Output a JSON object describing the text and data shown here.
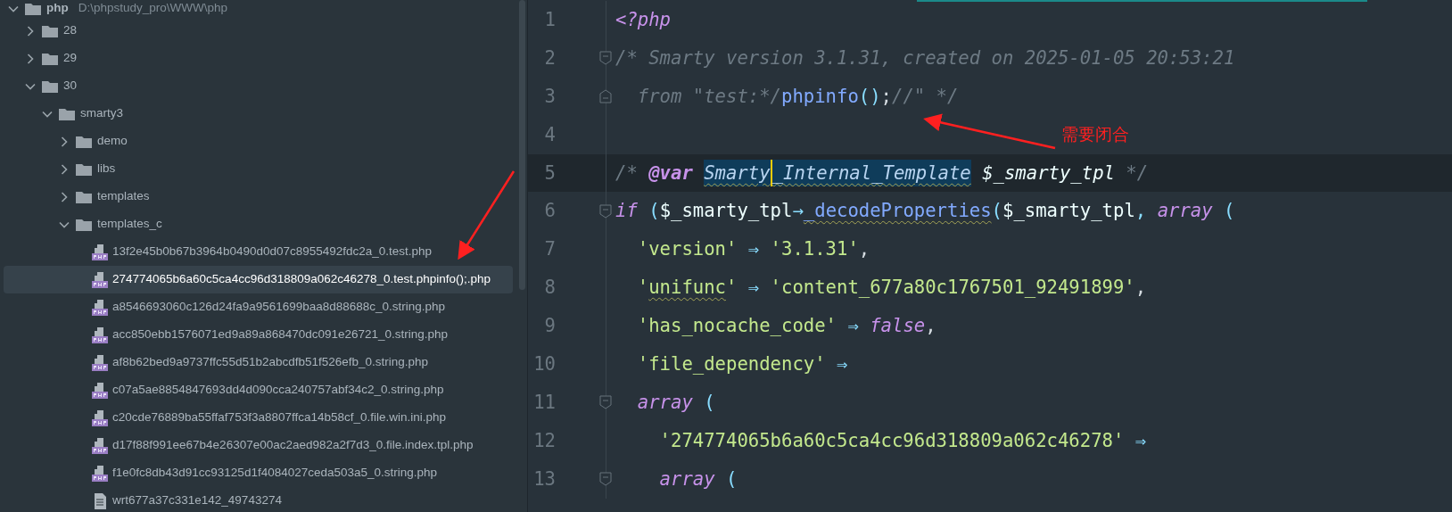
{
  "project_tree": {
    "items": [
      {
        "kind": "folder",
        "label": "php",
        "path": "D:\\phpstudy_pro\\WWW\\php",
        "expanded": true,
        "selected": false,
        "children": [
          {
            "kind": "folder",
            "label": "28",
            "expanded": false,
            "selected": false
          },
          {
            "kind": "folder",
            "label": "29",
            "expanded": false,
            "selected": false
          },
          {
            "kind": "folder",
            "label": "30",
            "expanded": true,
            "selected": false,
            "children": [
              {
                "kind": "folder",
                "label": "smarty3",
                "expanded": true,
                "selected": false,
                "children": [
                  {
                    "kind": "folder",
                    "label": "demo",
                    "expanded": false,
                    "selected": false
                  },
                  {
                    "kind": "folder",
                    "label": "libs",
                    "expanded": false,
                    "selected": false
                  },
                  {
                    "kind": "folder",
                    "label": "templates",
                    "expanded": false,
                    "selected": false
                  },
                  {
                    "kind": "folder",
                    "label": "templates_c",
                    "expanded": true,
                    "selected": false,
                    "children": [
                      {
                        "kind": "php",
                        "label": "13f2e45b0b67b3964b0490d0d07c8955492fdc2a_0.test.php",
                        "selected": false
                      },
                      {
                        "kind": "php",
                        "label": "274774065b6a60c5ca4cc96d318809a062c46278_0.test.phpinfo();.php",
                        "selected": true
                      },
                      {
                        "kind": "php",
                        "label": "a8546693060c126d24fa9a9561699baa8d88688c_0.string.php",
                        "selected": false
                      },
                      {
                        "kind": "php",
                        "label": "acc850ebb1576071ed9a89a868470dc091e26721_0.string.php",
                        "selected": false
                      },
                      {
                        "kind": "php",
                        "label": "af8b62bed9a9737ffc55d51b2abcdfb51f526efb_0.string.php",
                        "selected": false
                      },
                      {
                        "kind": "php",
                        "label": "c07a5ae8854847693dd4d090cca240757abf34c2_0.string.php",
                        "selected": false
                      },
                      {
                        "kind": "php",
                        "label": "c20cde76889ba55ffaf753f3a8807ffca14b58cf_0.file.win.ini.php",
                        "selected": false
                      },
                      {
                        "kind": "php",
                        "label": "d17f88f991ee67b4e26307e00ac2aed982a2f7d3_0.file.index.tpl.php",
                        "selected": false
                      },
                      {
                        "kind": "php",
                        "label": "f1e0fc8db43d91cc93125d1f4084027ceda503a5_0.string.php",
                        "selected": false
                      },
                      {
                        "kind": "file",
                        "label": "wrt677a37c331e142_49743274",
                        "selected": false
                      }
                    ]
                  }
                ]
              }
            ]
          }
        ]
      }
    ]
  },
  "editor": {
    "lines": [
      {
        "number": "1",
        "current": false,
        "kind": "plain",
        "segments": [
          {
            "kind": "keyword",
            "text": "<?php"
          }
        ]
      },
      {
        "number": "2",
        "current": false,
        "kind": "foldstart",
        "segments": [
          {
            "kind": "comment",
            "text": "/* Smarty version 3.1.31, created on 2025-01-05 20:53:21"
          }
        ]
      },
      {
        "number": "3",
        "current": false,
        "kind": "foldend",
        "segments": [
          {
            "kind": "comment",
            "text": "  from \"test:*/"
          },
          {
            "kind": "function",
            "text": "phpinfo"
          },
          {
            "kind": "paren",
            "text": "()"
          },
          {
            "kind": "plain",
            "text": ";"
          },
          {
            "kind": "comment",
            "text": "//\" */"
          }
        ]
      },
      {
        "number": "4",
        "current": false,
        "kind": "plain"
      },
      {
        "number": "5",
        "current": true,
        "kind": "plain",
        "segments": [
          {
            "kind": "comment",
            "text": "/* "
          },
          {
            "kind": "doctag",
            "text": "@var"
          },
          {
            "kind": "type",
            "text": "Smarty",
            "selected": true,
            "caret": true,
            "squiggly": true
          },
          {
            "kind": "type",
            "text": "_Internal_Template",
            "selected": true,
            "squiggly": true
          },
          {
            "kind": "doctype",
            "text": " $_smarty_tpl"
          },
          {
            "kind": "comment",
            "text": " */"
          }
        ]
      },
      {
        "number": "6",
        "current": false,
        "kind": "foldstart",
        "segments": [
          {
            "kind": "keyword",
            "text": "if"
          },
          {
            "kind": "paren",
            "text": " ("
          },
          {
            "kind": "variable",
            "text": "$_smarty_tpl"
          },
          {
            "kind": "operator",
            "text": "→"
          },
          {
            "kind": "function",
            "text": "_decodeProperties",
            "squiggly": true
          },
          {
            "kind": "paren",
            "text": "("
          },
          {
            "kind": "variable",
            "text": "$_smarty_tpl"
          },
          {
            "kind": "operator",
            "text": ", "
          },
          {
            "kind": "keyword",
            "text": "array"
          },
          {
            "kind": "paren",
            "text": " ("
          }
        ]
      },
      {
        "number": "7",
        "current": false,
        "kind": "plain",
        "segments": [
          {
            "kind": "string",
            "text": "  'version'"
          },
          {
            "kind": "operator",
            "text": " ⇒ "
          },
          {
            "kind": "string",
            "text": "'3.1.31'"
          },
          {
            "kind": "plain",
            "text": ","
          }
        ]
      },
      {
        "number": "8",
        "current": false,
        "kind": "plain",
        "segments": [
          {
            "kind": "string",
            "text": "  '"
          },
          {
            "kind": "string",
            "text": "unifunc",
            "squiggly": true
          },
          {
            "kind": "string",
            "text": "'"
          },
          {
            "kind": "operator",
            "text": " ⇒ "
          },
          {
            "kind": "string",
            "text": "'content_677a80c1767501_92491899'"
          },
          {
            "kind": "plain",
            "text": ","
          }
        ]
      },
      {
        "number": "9",
        "current": false,
        "kind": "plain",
        "segments": [
          {
            "kind": "string",
            "text": "  'has_nocache_code'"
          },
          {
            "kind": "operator",
            "text": " ⇒ "
          },
          {
            "kind": "keyword",
            "text": "false"
          },
          {
            "kind": "plain",
            "text": ","
          }
        ]
      },
      {
        "number": "10",
        "current": false,
        "kind": "plain",
        "segments": [
          {
            "kind": "string",
            "text": "  'file_dependency'"
          },
          {
            "kind": "operator",
            "text": " ⇒"
          }
        ]
      },
      {
        "number": "11",
        "current": false,
        "kind": "foldstart",
        "segments": [
          {
            "kind": "keyword",
            "text": "  array"
          },
          {
            "kind": "paren",
            "text": " ("
          }
        ]
      },
      {
        "number": "12",
        "current": false,
        "kind": "plain",
        "segments": [
          {
            "kind": "string",
            "text": "    '274774065b6a60c5ca4cc96d318809a062c46278'"
          },
          {
            "kind": "operator",
            "text": " ⇒"
          }
        ]
      },
      {
        "number": "13",
        "current": false,
        "kind": "foldstart",
        "segments": [
          {
            "kind": "keyword",
            "text": "    array"
          },
          {
            "kind": "paren",
            "text": " ("
          }
        ]
      }
    ]
  },
  "annotation": {
    "note": "需要闭合"
  }
}
